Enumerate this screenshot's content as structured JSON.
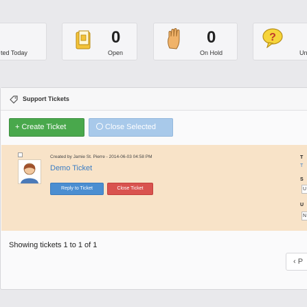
{
  "stats": [
    {
      "label": "ted Today",
      "value": ""
    },
    {
      "label": "Open",
      "value": "0"
    },
    {
      "label": "On Hold",
      "value": "0"
    },
    {
      "label": "Un",
      "value": ""
    }
  ],
  "panel": {
    "title": "Support Tickets",
    "create_label": "+ Create Ticket",
    "close_selected_label": "Close Selected"
  },
  "ticket": {
    "meta": "Created by Jamie St. Pierre - 2014-06-03 04:58 PM",
    "title": "Demo Ticket",
    "reply_label": "Reply to Ticket",
    "close_label": "Close Ticket",
    "side_labels": [
      "T",
      "T",
      "S",
      "U",
      "U",
      "N"
    ]
  },
  "footer": {
    "showing": "Showing tickets 1 to 1 of 1",
    "pager": "‹ P"
  },
  "colors": {
    "create": "#49a84c",
    "close_selected": "#a8c9ea",
    "reply": "#4b8ed1",
    "close_ticket": "#d9534f",
    "ticket_row": "#f8e3c8"
  }
}
